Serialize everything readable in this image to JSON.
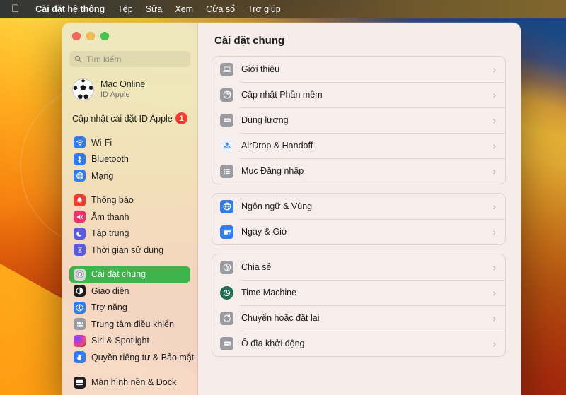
{
  "menubar": {
    "apple_icon": "apple-logo-icon",
    "items": [
      {
        "label": "Cài đặt hệ thống",
        "bold": true
      },
      {
        "label": "Tệp",
        "bold": false
      },
      {
        "label": "Sửa",
        "bold": false
      },
      {
        "label": "Xem",
        "bold": false
      },
      {
        "label": "Cửa sổ",
        "bold": false
      },
      {
        "label": "Trợ giúp",
        "bold": false
      }
    ]
  },
  "window": {
    "traffic_lights": {
      "close": "close-button",
      "minimize": "minimize-button",
      "maximize": "maximize-button",
      "close_color": "#f5655b",
      "minimize_color": "#f6bd50",
      "maximize_color": "#3ec84c"
    }
  },
  "sidebar": {
    "search": {
      "placeholder": "Tìm kiếm",
      "value": "",
      "icon": "search-icon"
    },
    "account": {
      "name": "Mac Online",
      "subtitle": "ID Apple",
      "avatar": "soccer-ball-avatar"
    },
    "apple_id_update": {
      "label": "Cập nhật cài đặt ID Apple",
      "badge": "1",
      "badge_color": "#ff3b30"
    },
    "selected_item": "Cài đặt chung",
    "selection_color": "#3cb44a",
    "groups": [
      {
        "items": [
          {
            "label": "Wi-Fi",
            "icon": "wifi-icon",
            "color": "#2f7cf6"
          },
          {
            "label": "Bluetooth",
            "icon": "bluetooth-icon",
            "color": "#2f7cf6"
          },
          {
            "label": "Mạng",
            "icon": "network-globe-icon",
            "color": "#2f7cf6"
          }
        ]
      },
      {
        "items": [
          {
            "label": "Thông báo",
            "icon": "notifications-bell-icon",
            "color": "#f03b2e"
          },
          {
            "label": "Âm thanh",
            "icon": "sound-speaker-icon",
            "color": "#f0306a"
          },
          {
            "label": "Tập trung",
            "icon": "focus-moon-icon",
            "color": "#5a5ce0"
          },
          {
            "label": "Thời gian sử dụng",
            "icon": "screen-time-hourglass-icon",
            "color": "#5a5ce0"
          }
        ]
      },
      {
        "items": [
          {
            "label": "Cài đặt chung",
            "icon": "general-gear-icon",
            "color": "#8e8e93",
            "selected": true
          },
          {
            "label": "Giao diện",
            "icon": "appearance-contrast-icon",
            "color": "#1c1c1e"
          },
          {
            "label": "Trợ năng",
            "icon": "accessibility-icon",
            "color": "#2f7cf6"
          },
          {
            "label": "Trung tâm điều khiển",
            "icon": "control-center-icon",
            "color": "#8e8e93"
          },
          {
            "label": "Siri & Spotlight",
            "icon": "siri-icon",
            "color": "#c34bd0"
          },
          {
            "label": "Quyền riêng tư & Bảo mật",
            "icon": "privacy-hand-icon",
            "color": "#2f7cf6"
          }
        ]
      },
      {
        "items": [
          {
            "label": "Màn hình nền & Dock",
            "icon": "desktop-dock-icon",
            "color": "#1c1c1e"
          }
        ]
      }
    ]
  },
  "main": {
    "title": "Cài đặt chung",
    "groups": [
      {
        "rows": [
          {
            "label": "Giới thiệu",
            "icon": "about-laptop-icon",
            "color": "#8e8e93"
          },
          {
            "label": "Cập nhật Phần mềm",
            "icon": "software-update-gear-icon",
            "color": "#8e8e93"
          },
          {
            "label": "Dung lượng",
            "icon": "storage-drive-icon",
            "color": "#8e8e93"
          },
          {
            "label": "AirDrop & Handoff",
            "icon": "airdrop-icon",
            "color": "#eef2f6"
          },
          {
            "label": "Mục Đăng nhập",
            "icon": "login-items-list-icon",
            "color": "#8e8e93"
          }
        ]
      },
      {
        "rows": [
          {
            "label": "Ngôn ngữ & Vùng",
            "icon": "language-globe-icon",
            "color": "#2f7cf6"
          },
          {
            "label": "Ngày & Giờ",
            "icon": "date-time-icon",
            "color": "#2f7cf6"
          }
        ]
      },
      {
        "rows": [
          {
            "label": "Chia sẻ",
            "icon": "sharing-icon",
            "color": "#8e8e93"
          },
          {
            "label": "Time Machine",
            "icon": "time-machine-icon",
            "color": "#1f6f52"
          },
          {
            "label": "Chuyển hoặc đặt lại",
            "icon": "transfer-reset-icon",
            "color": "#8e8e93"
          },
          {
            "label": "Ổ đĩa khởi động",
            "icon": "startup-disk-icon",
            "color": "#8e8e93"
          }
        ]
      }
    ],
    "chevron": "chevron-right-icon"
  }
}
